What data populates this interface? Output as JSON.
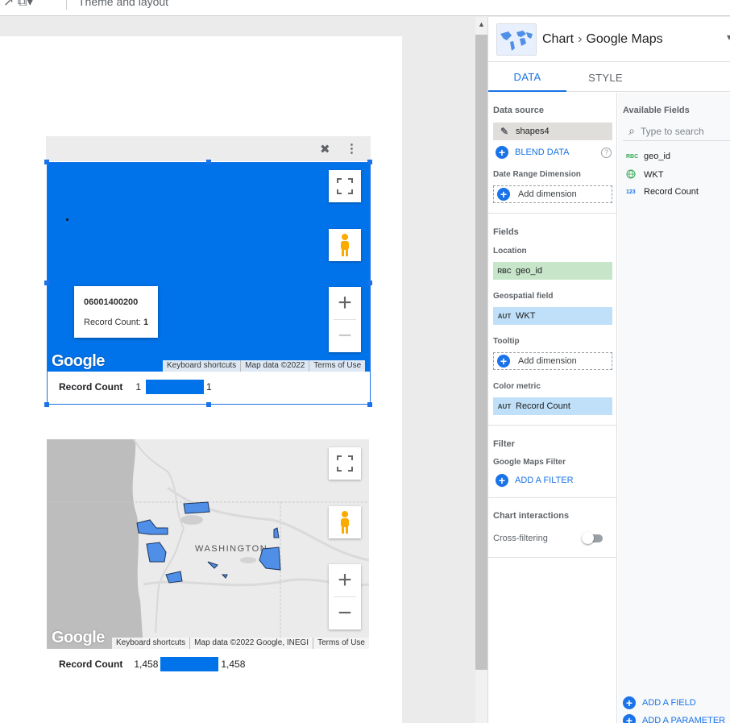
{
  "toolbar": {
    "title": "Theme and layout"
  },
  "map1": {
    "tooltip": {
      "title": "06001400200",
      "label": "Record Count: ",
      "value": "1"
    },
    "footer": {
      "shortcuts": "Keyboard shortcuts",
      "mapdata": "Map data ©2022",
      "terms": "Terms of Use"
    },
    "legend": {
      "label": "Record Count",
      "min": "1",
      "max": "1"
    },
    "logo": "Google"
  },
  "map2": {
    "state_label": "WASHINGTON",
    "footer": {
      "shortcuts": "Keyboard shortcuts",
      "mapdata": "Map data ©2022 Google, INEGI",
      "terms": "Terms of Use"
    },
    "legend": {
      "label": "Record Count",
      "min": "1,458",
      "max": "1,458"
    },
    "logo": "Google"
  },
  "colors": {
    "map_fill": "#0073ea",
    "accent": "#1a73e8",
    "region_fill": "#4f8fe8"
  },
  "panel": {
    "chart_label": "Chart",
    "chart_type": "Google Maps",
    "tabs": [
      "DATA",
      "STYLE"
    ],
    "data_source": {
      "title": "Data source",
      "name": "shapes4",
      "blend": "BLEND DATA"
    },
    "date_range": {
      "title": "Date Range Dimension",
      "add": "Add dimension"
    },
    "fields": {
      "title": "Fields",
      "location": {
        "title": "Location",
        "type": "RBC",
        "value": "geo_id"
      },
      "geospatial": {
        "title": "Geospatial field",
        "type": "AUT",
        "value": "WKT"
      },
      "tooltip": {
        "title": "Tooltip",
        "add": "Add dimension"
      },
      "color_metric": {
        "title": "Color metric",
        "type": "AUT",
        "value": "Record Count"
      }
    },
    "filter": {
      "title": "Filter",
      "sub": "Google Maps Filter",
      "add": "ADD A FILTER"
    },
    "interactions": {
      "title": "Chart interactions",
      "cross": "Cross-filtering",
      "cross_enabled": false
    },
    "available": {
      "title": "Available Fields",
      "search_placeholder": "Type to search",
      "items": [
        {
          "type": "RBC",
          "name": "geo_id"
        },
        {
          "type": "globe",
          "name": "WKT"
        },
        {
          "type": "123",
          "name": "Record Count"
        }
      ],
      "add_field": "ADD A FIELD",
      "add_parameter": "ADD A PARAMETER"
    }
  }
}
